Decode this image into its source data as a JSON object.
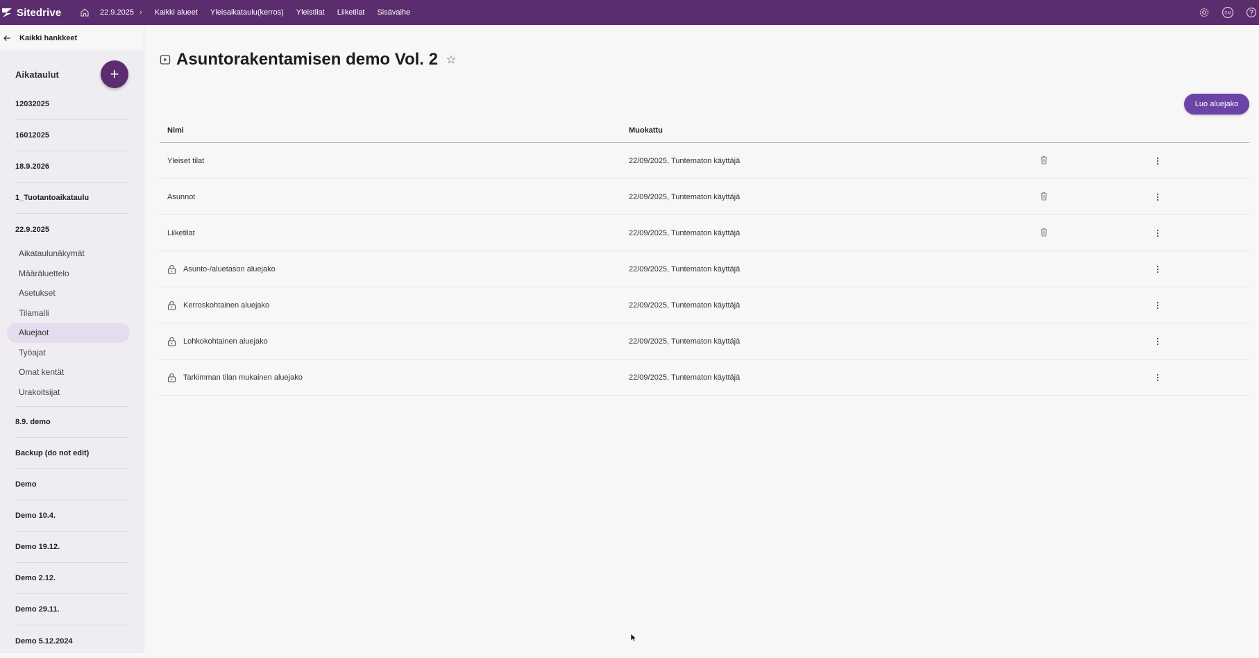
{
  "app": {
    "name": "Sitedrive"
  },
  "topbar": {
    "breadcrumb": "22.9.2025",
    "links": [
      "Kaikki alueet",
      "Yleisaikataulu(kerros)",
      "Yleistilat",
      "Liiketilat",
      "Sisävaihe"
    ],
    "icons": [
      "settings-icon",
      "user-avatar-icon",
      "help-icon"
    ],
    "avatar_initials": "SM",
    "background": "#5b2d6e"
  },
  "sidebar": {
    "back_label": "Kaikki hankkeet",
    "schedules_title": "Aikataulut",
    "add_label": "+",
    "schedules_top": [
      "12032025",
      "16012025",
      "18.9.2026",
      "1_Tuotantoaikataulu"
    ],
    "open_schedule": "22.9.2025",
    "subnav": [
      {
        "label": "Aikataulunäkymät",
        "active": false
      },
      {
        "label": "Määräluettelo",
        "active": false
      },
      {
        "label": "Asetukset",
        "active": false
      },
      {
        "label": "Tilamalli",
        "active": false
      },
      {
        "label": "Aluejaot",
        "active": true
      },
      {
        "label": "Työajat",
        "active": false
      },
      {
        "label": "Omat kentät",
        "active": false
      },
      {
        "label": "Urakoitsijat",
        "active": false
      }
    ],
    "schedules_bottom": [
      "8.9. demo",
      "Backup (do not edit)",
      "Demo",
      "Demo 10.4.",
      "Demo 19.12.",
      "Demo 2.12.",
      "Demo 29.11.",
      "Demo 5.12.2024"
    ]
  },
  "main": {
    "title": "Asuntorakentamisen demo Vol. 2",
    "create_button": "Luo aluejako",
    "accent": "#6a44a6",
    "table": {
      "headers": {
        "name": "Nimi",
        "modified": "Muokattu"
      },
      "rows": [
        {
          "name": "Yleiset tilat",
          "modified": "22/09/2025, Tuntematon käyttäjä",
          "locked": false,
          "deletable": true
        },
        {
          "name": "Asunnot",
          "modified": "22/09/2025, Tuntematon käyttäjä",
          "locked": false,
          "deletable": true
        },
        {
          "name": "Liiketilat",
          "modified": "22/09/2025, Tuntematon käyttäjä",
          "locked": false,
          "deletable": true
        },
        {
          "name": "Asunto-/aluetason aluejako",
          "modified": "22/09/2025, Tuntematon käyttäjä",
          "locked": true,
          "deletable": false
        },
        {
          "name": "Kerroskohtainen aluejako",
          "modified": "22/09/2025, Tuntematon käyttäjä",
          "locked": true,
          "deletable": false
        },
        {
          "name": "Lohkokohtainen aluejako",
          "modified": "22/09/2025, Tuntematon käyttäjä",
          "locked": true,
          "deletable": false
        },
        {
          "name": "Tarkimman tilan mukainen aluejako",
          "modified": "22/09/2025, Tuntematon käyttäjä",
          "locked": true,
          "deletable": false
        }
      ]
    }
  }
}
